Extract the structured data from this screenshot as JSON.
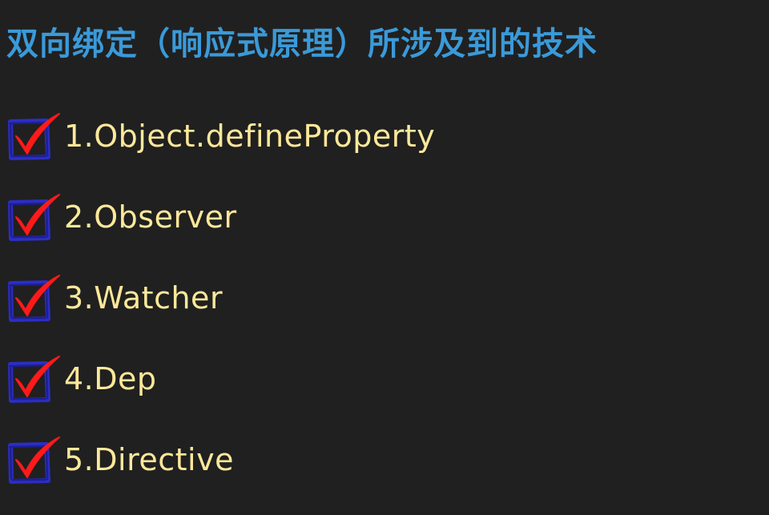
{
  "title": "双向绑定（响应式原理）所涉及到的技术",
  "colors": {
    "background": "#202020",
    "title": "#3a9ad9",
    "item_text": "#fde89a",
    "checkbox_border": "#2c2ec4",
    "checkmark": "#ff1a1a"
  },
  "items": [
    {
      "label": "1.Object.defineProperty",
      "checked": true,
      "icon": "checked-box-icon"
    },
    {
      "label": "2.Observer",
      "checked": true,
      "icon": "checked-box-icon"
    },
    {
      "label": "3.Watcher",
      "checked": true,
      "icon": "checked-box-icon"
    },
    {
      "label": "4.Dep",
      "checked": true,
      "icon": "checked-box-icon"
    },
    {
      "label": "5.Directive",
      "checked": true,
      "icon": "checked-box-icon"
    }
  ]
}
